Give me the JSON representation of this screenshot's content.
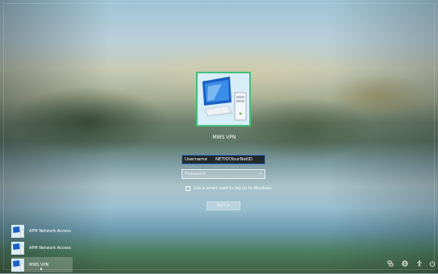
{
  "login": {
    "account_name": "MWS VPN",
    "username_label": "Username",
    "username_value": "NETID\\YourNetID",
    "password_placeholder": "Password",
    "smart_card_label": "Use a smart card to log on to Windows",
    "sign_in_button": "Sign in",
    "reveal_icon": "→"
  },
  "users": [
    {
      "label": "APM Network Access",
      "icon": "computer-icon"
    },
    {
      "label": "APM Network Access",
      "icon": "computer-icon"
    },
    {
      "label": "MWS VPN",
      "icon": "computer-icon",
      "selected": true
    }
  ],
  "tray": {
    "network_icon": "network-icon",
    "globe_icon": "globe-icon",
    "accessibility_icon": "accessibility-icon",
    "power_icon": "power-icon"
  },
  "colors": {
    "tile_border": "#45c07a",
    "focus_border": "#3a7ad6"
  }
}
